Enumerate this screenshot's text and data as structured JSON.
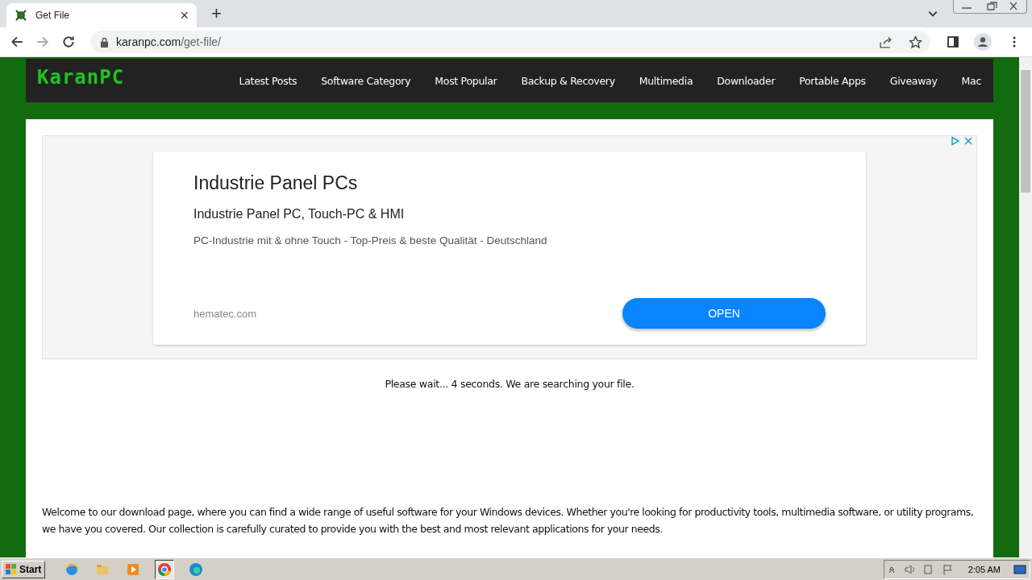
{
  "browser": {
    "tab": {
      "title": "Get File",
      "close": "×"
    },
    "new_tab": "+",
    "url": {
      "host": "karanpc.com",
      "path": "/get-file/"
    }
  },
  "site": {
    "logo": "KaranPC",
    "nav": [
      "Latest Posts",
      "Software Category",
      "Most Popular",
      "Backup & Recovery",
      "Multimedia",
      "Downloader",
      "Portable Apps",
      "Giveaway",
      "Mac"
    ]
  },
  "ad": {
    "title": "Industrie Panel PCs",
    "subtitle": "Industrie Panel PC, Touch-PC & HMI",
    "description": "PC-Industrie mit & ohne Touch - Top-Preis & beste Qualität - Deutschland",
    "domain": "hematec.com",
    "button": "OPEN"
  },
  "wait_message": "Please wait... 4 seconds. We are searching your file.",
  "intro": "Welcome to our download page, where you can find a wide range of useful software for your Windows devices. Whether you're looking for productivity tools, multimedia software, or utility programs, we have you covered. Our collection is carefully curated to provide you with the best and most relevant applications for your needs.",
  "taskbar": {
    "start": "Start",
    "clock": "2:05 AM"
  }
}
